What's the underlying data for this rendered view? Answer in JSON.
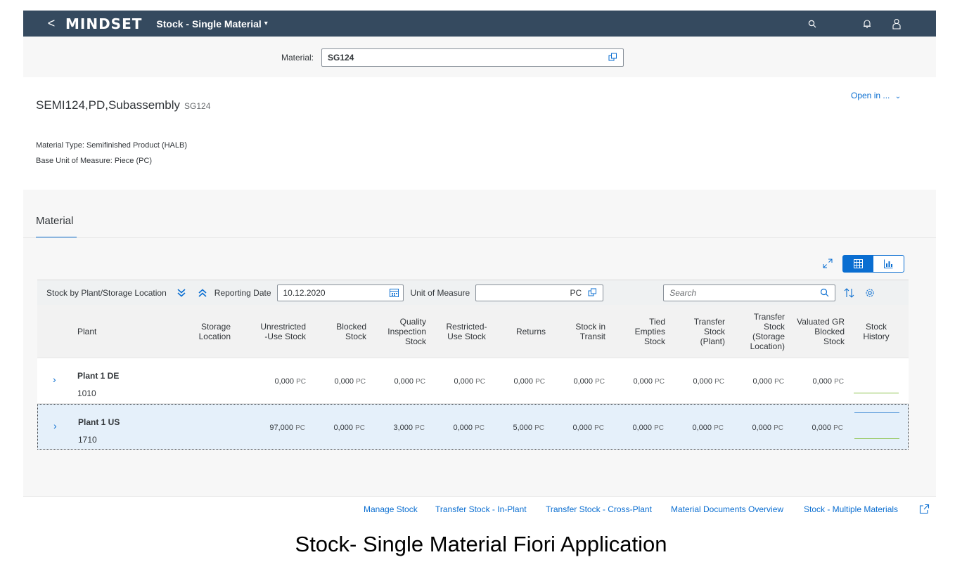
{
  "shell": {
    "back": "<",
    "logo": "MINDSET",
    "app_title": "Stock - Single Material",
    "caret": "▾"
  },
  "filter": {
    "label": "Material:",
    "value": "SG124"
  },
  "header": {
    "title": "SEMI124,PD,Subassembly",
    "subtitle": "SG124",
    "open_in": "Open in ...",
    "material_type": "Material Type: Semifinished Product (HALB)",
    "base_unit": "Base Unit of Measure: Piece (PC)"
  },
  "section": {
    "tab": "Material"
  },
  "toolbar": {
    "title": "Stock by Plant/Storage Location",
    "reporting_label": "Reporting Date",
    "reporting_value": "10.12.2020",
    "uom_label": "Unit of Measure",
    "uom_value": "PC",
    "search_placeholder": "Search"
  },
  "columns": {
    "plant": "Plant",
    "storage": [
      "Storage",
      "Location"
    ],
    "unrestricted": [
      "Unrestricted",
      "-Use Stock"
    ],
    "blocked": [
      "Blocked",
      "Stock"
    ],
    "quality": [
      "Quality",
      "Inspection",
      "Stock"
    ],
    "restricted": [
      "Restricted-",
      "Use Stock"
    ],
    "returns": "Returns",
    "transit": [
      "Stock in",
      "Transit"
    ],
    "tied": [
      "Tied",
      "Empties",
      "Stock"
    ],
    "transfer_plant": [
      "Transfer",
      "Stock",
      "(Plant)"
    ],
    "transfer_sloc": [
      "Transfer",
      "Stock",
      "(Storage",
      "Location)"
    ],
    "valuated": [
      "Valuated GR",
      "Blocked",
      "Stock"
    ],
    "history": [
      "Stock",
      "History"
    ]
  },
  "rows": [
    {
      "name": "Plant 1 DE",
      "code": "1010",
      "values": [
        "0,000",
        "0,000",
        "0,000",
        "0,000",
        "0,000",
        "0,000",
        "0,000",
        "0,000",
        "0,000",
        "0,000"
      ],
      "unit": "PC"
    },
    {
      "name": "Plant 1 US",
      "code": "1710",
      "values": [
        "97,000",
        "0,000",
        "3,000",
        "0,000",
        "5,000",
        "0,000",
        "0,000",
        "0,000",
        "0,000",
        "0,000"
      ],
      "unit": "PC"
    }
  ],
  "footer": {
    "links": [
      "Manage Stock",
      "Transfer Stock - In-Plant",
      "Transfer Stock - Cross-Plant",
      "Material Documents Overview",
      "Stock - Multiple Materials"
    ]
  },
  "caption": "Stock- Single Material Fiori Application",
  "colors": {
    "shell": "#354a5f",
    "accent": "#0a6ed1",
    "chart_green": "#8bc34a",
    "chart_blue": "#5899da"
  },
  "icons": [
    "back-icon",
    "search-icon",
    "bell-icon",
    "user-icon",
    "value-help-icon",
    "fullscreen-icon",
    "table-view-icon",
    "chart-view-icon",
    "collapse-down-icon",
    "expand-up-icon",
    "calendar-icon",
    "sort-icon",
    "settings-icon",
    "share-icon"
  ]
}
